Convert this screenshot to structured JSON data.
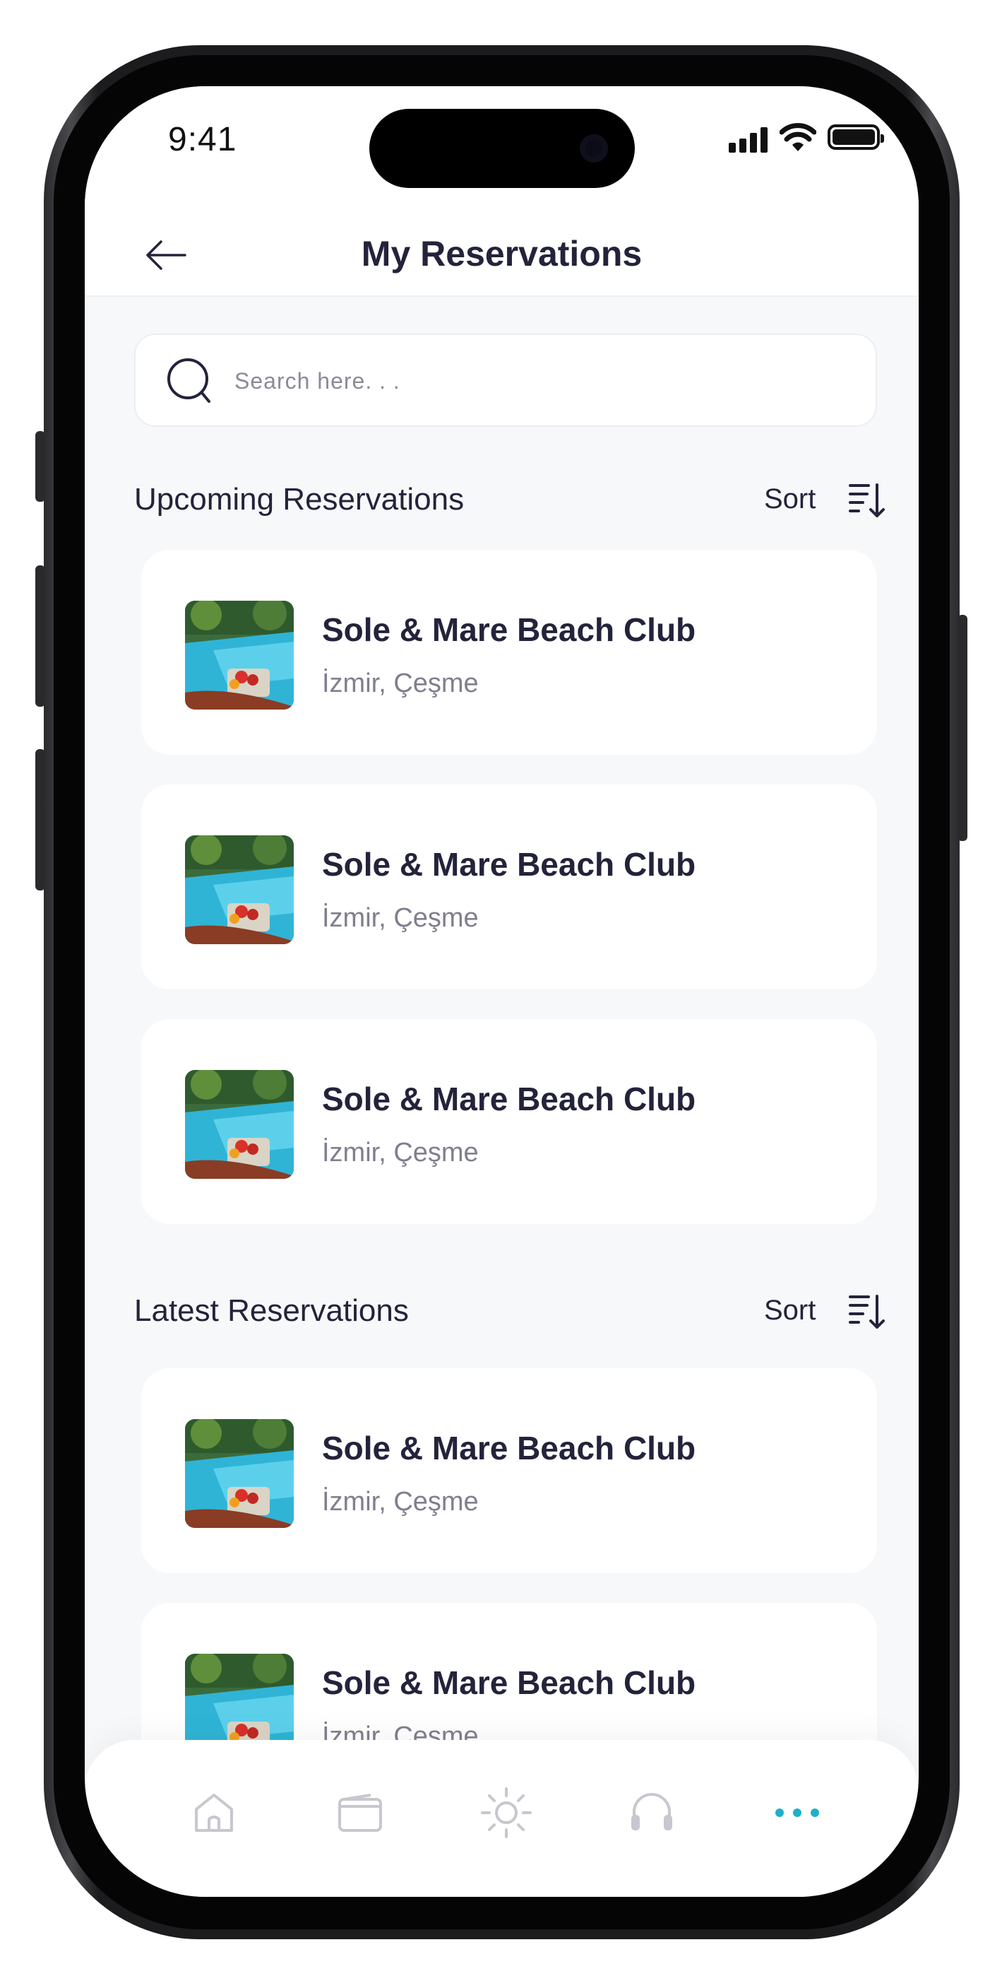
{
  "status_bar": {
    "time": "9:41"
  },
  "header": {
    "title": "My Reservations"
  },
  "search": {
    "placeholder": "Search here. . ."
  },
  "upcoming": {
    "title": "Upcoming Reservations",
    "sort_label": "Sort",
    "items": [
      {
        "name": "Sole & Mare Beach Club",
        "location": "İzmir, Çeşme"
      },
      {
        "name": "Sole & Mare Beach Club",
        "location": "İzmir, Çeşme"
      },
      {
        "name": "Sole & Mare Beach Club",
        "location": "İzmir, Çeşme"
      }
    ]
  },
  "latest": {
    "title": "Latest Reservations",
    "sort_label": "Sort",
    "items": [
      {
        "name": "Sole & Mare Beach Club",
        "location": "İzmir, Çeşme"
      },
      {
        "name": "Sole & Mare Beach Club",
        "location": "İzmir, Çeşme"
      }
    ]
  },
  "tab_bar": {
    "tabs": [
      {
        "icon": "home-icon",
        "active": false
      },
      {
        "icon": "wallet-icon",
        "active": false
      },
      {
        "icon": "sun-icon",
        "active": false
      },
      {
        "icon": "headphones-icon",
        "active": false
      },
      {
        "icon": "more-icon",
        "active": true
      }
    ],
    "active_color": "#1fb0c9",
    "inactive_color": "#c7c7cf"
  }
}
